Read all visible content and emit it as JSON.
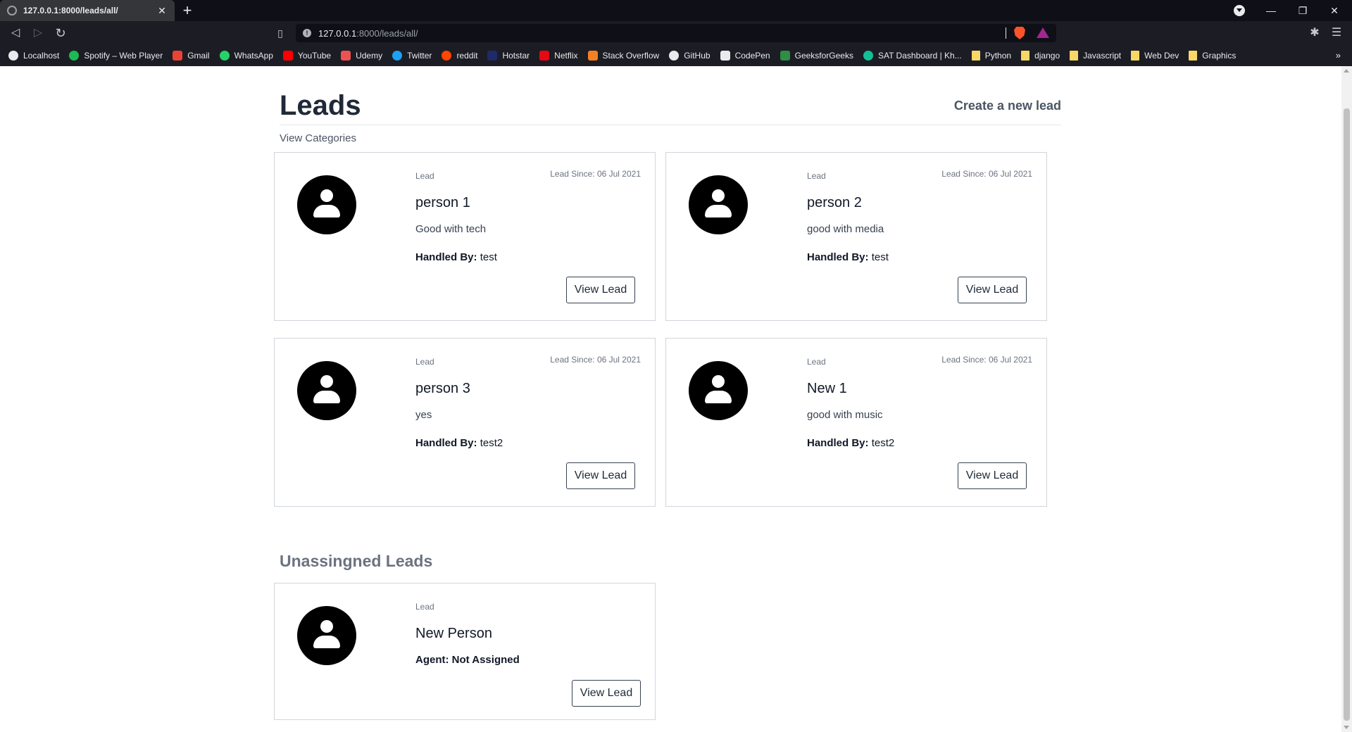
{
  "browser": {
    "tab_title": "127.0.0.1:8000/leads/all/",
    "tab_close": "✕",
    "new_tab": "+",
    "url_host": "127.0.0.1",
    "url_path": ":8000/leads/all/",
    "window_controls": {
      "minimize": "—",
      "maximize": "❐",
      "close": "✕"
    },
    "bookmarks": [
      {
        "label": "Localhost",
        "color": "#e8eaed",
        "round": true
      },
      {
        "label": "Spotify – Web Player",
        "color": "#1db954",
        "round": true
      },
      {
        "label": "Gmail",
        "color": "#ea4335",
        "round": false
      },
      {
        "label": "WhatsApp",
        "color": "#25d366",
        "round": true
      },
      {
        "label": "YouTube",
        "color": "#ff0000",
        "round": false
      },
      {
        "label": "Udemy",
        "color": "#ec5252",
        "round": false
      },
      {
        "label": "Twitter",
        "color": "#1da1f2",
        "round": true
      },
      {
        "label": "reddit",
        "color": "#ff4500",
        "round": true
      },
      {
        "label": "Hotstar",
        "color": "#1f2a6b",
        "round": false
      },
      {
        "label": "Netflix",
        "color": "#e50914",
        "round": false
      },
      {
        "label": "Stack Overflow",
        "color": "#f48024",
        "round": false
      },
      {
        "label": "GitHub",
        "color": "#e8eaed",
        "round": true
      },
      {
        "label": "CodePen",
        "color": "#e8eaed",
        "round": false
      },
      {
        "label": "GeeksforGeeks",
        "color": "#2f8d46",
        "round": false
      },
      {
        "label": "SAT Dashboard | Kh...",
        "color": "#14bf96",
        "round": true
      },
      {
        "label": "Python",
        "folder": true
      },
      {
        "label": "django",
        "folder": true
      },
      {
        "label": "Javascript",
        "folder": true
      },
      {
        "label": "Web Dev",
        "folder": true
      },
      {
        "label": "Graphics",
        "folder": true
      }
    ],
    "bookmarks_more": "»"
  },
  "page": {
    "title": "Leads",
    "create_link": "Create a new lead",
    "view_categories": "View Categories",
    "leads": [
      {
        "kind": "Lead",
        "since": "Lead Since: 06 Jul 2021",
        "name": "person 1",
        "desc": "Good with tech",
        "handled_label": "Handled By:",
        "handled_by": "test",
        "button": "View Lead"
      },
      {
        "kind": "Lead",
        "since": "Lead Since: 06 Jul 2021",
        "name": "person 2",
        "desc": "good with media",
        "handled_label": "Handled By:",
        "handled_by": "test",
        "button": "View Lead"
      },
      {
        "kind": "Lead",
        "since": "Lead Since: 06 Jul 2021",
        "name": "person 3",
        "desc": "yes",
        "handled_label": "Handled By:",
        "handled_by": "test2",
        "button": "View Lead"
      },
      {
        "kind": "Lead",
        "since": "Lead Since: 06 Jul 2021",
        "name": "New 1",
        "desc": "good with music",
        "handled_label": "Handled By:",
        "handled_by": "test2",
        "button": "View Lead"
      }
    ],
    "unassigned_title": "Unassingned Leads",
    "unassigned": [
      {
        "kind": "Lead",
        "name": "New Person",
        "agent": "Agent: Not Assigned",
        "button": "View Lead"
      }
    ]
  }
}
